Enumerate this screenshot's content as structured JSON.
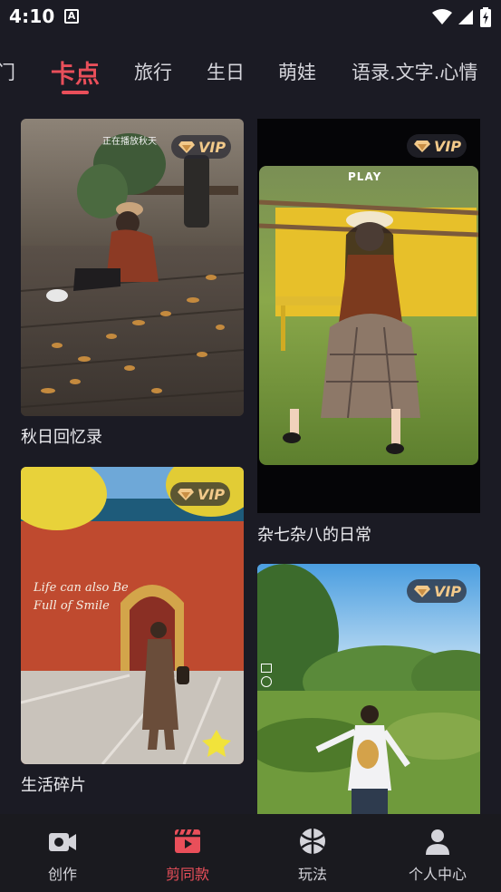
{
  "status_bar": {
    "time": "4:10",
    "notification_icon": "A"
  },
  "tabs": {
    "items": [
      {
        "label": "门"
      },
      {
        "label": "卡点",
        "active": true
      },
      {
        "label": "旅行"
      },
      {
        "label": "生日"
      },
      {
        "label": "萌娃"
      },
      {
        "label": "语录.文字.心情"
      }
    ]
  },
  "cards": [
    {
      "title": "秋日回忆录",
      "badge": "VIP",
      "overlay_text": "正在播放秋天"
    },
    {
      "title": "杂七杂八的日常",
      "badge": "VIP",
      "overlay_text": "PLAY"
    },
    {
      "title": "生活碎片",
      "badge": "VIP",
      "overlay_text": "Life can also Be Full of Smile"
    },
    {
      "title": "",
      "badge": "VIP"
    }
  ],
  "bottom_nav": {
    "items": [
      {
        "label": "创作",
        "icon": "video-camera-icon"
      },
      {
        "label": "剪同款",
        "icon": "clapperboard-icon",
        "active": true
      },
      {
        "label": "玩法",
        "icon": "ball-icon"
      },
      {
        "label": "个人中心",
        "icon": "person-icon"
      }
    ]
  },
  "colors": {
    "background": "#1b1b24",
    "accent": "#e94f5a",
    "vip_gold": "#f2c98a",
    "nav_background": "#1a1a1f"
  }
}
